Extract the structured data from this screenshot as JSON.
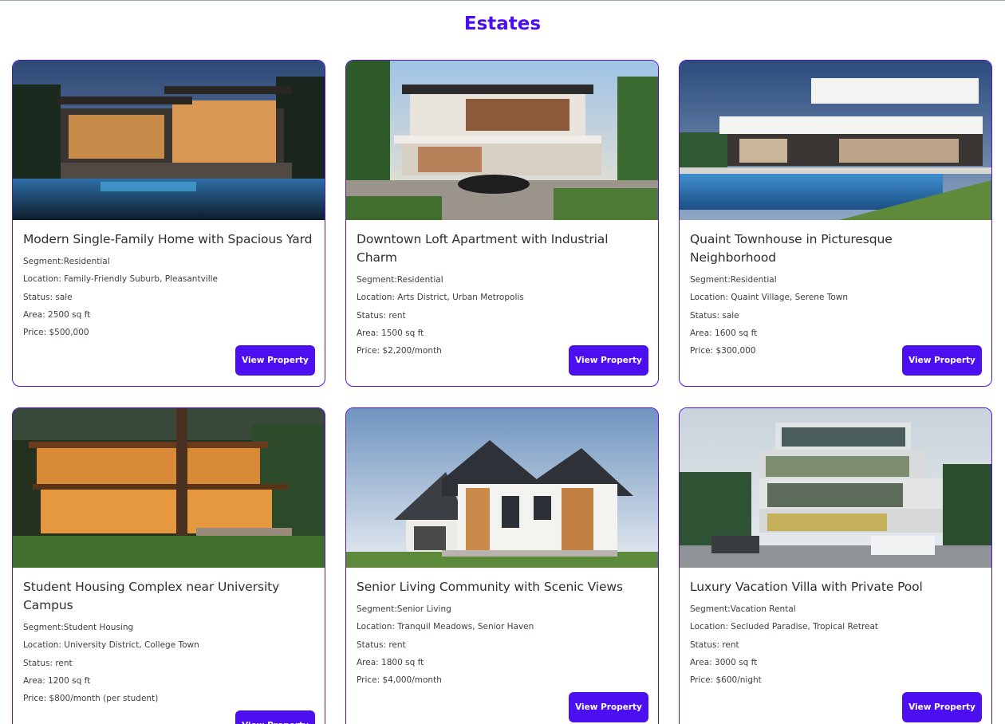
{
  "page": {
    "title": "Estates"
  },
  "common": {
    "segment_prefix": "Segment:",
    "location_prefix": "Location: ",
    "status_prefix": "Status: ",
    "area_prefix": "Area: ",
    "price_prefix": "Price: ",
    "button_label": "View Property"
  },
  "properties": [
    {
      "title": "Modern Single-Family Home with Spacious Yard",
      "segment": "Residential",
      "location": "Family-Friendly Suburb, Pleasantville",
      "status": "sale",
      "area": "2500 sq ft",
      "price": "$500,000",
      "image": "modern-home-night-pool"
    },
    {
      "title": "Downtown Loft Apartment with Industrial Charm",
      "segment": "Residential",
      "location": "Arts District, Urban Metropolis",
      "status": "rent",
      "area": "1500 sq ft",
      "price": "$2,200/month",
      "image": "palm-villa-with-car"
    },
    {
      "title": "Quaint Townhouse in Picturesque Neighborhood",
      "segment": "Residential",
      "location": "Quaint Village, Serene Town",
      "status": "sale",
      "area": "1600 sq ft",
      "price": "$300,000",
      "image": "white-villa-pool"
    },
    {
      "title": "Student Housing Complex near University Campus",
      "segment": "Student Housing",
      "location": "University District, College Town",
      "status": "rent",
      "area": "1200 sq ft",
      "price": "$800/month (per student)",
      "image": "forest-wood-house"
    },
    {
      "title": "Senior Living Community with Scenic Views",
      "segment": "Senior Living",
      "location": "Tranquil Meadows, Senior Haven",
      "status": "rent",
      "area": "1800 sq ft",
      "price": "$4,000/month",
      "image": "suburban-gable-house"
    },
    {
      "title": "Luxury Vacation Villa with Private Pool",
      "segment": "Vacation Rental",
      "location": "Secluded Paradise, Tropical Retreat",
      "status": "rent",
      "area": "3000 sq ft",
      "price": "$600/night",
      "image": "glass-apartment-building"
    }
  ]
}
